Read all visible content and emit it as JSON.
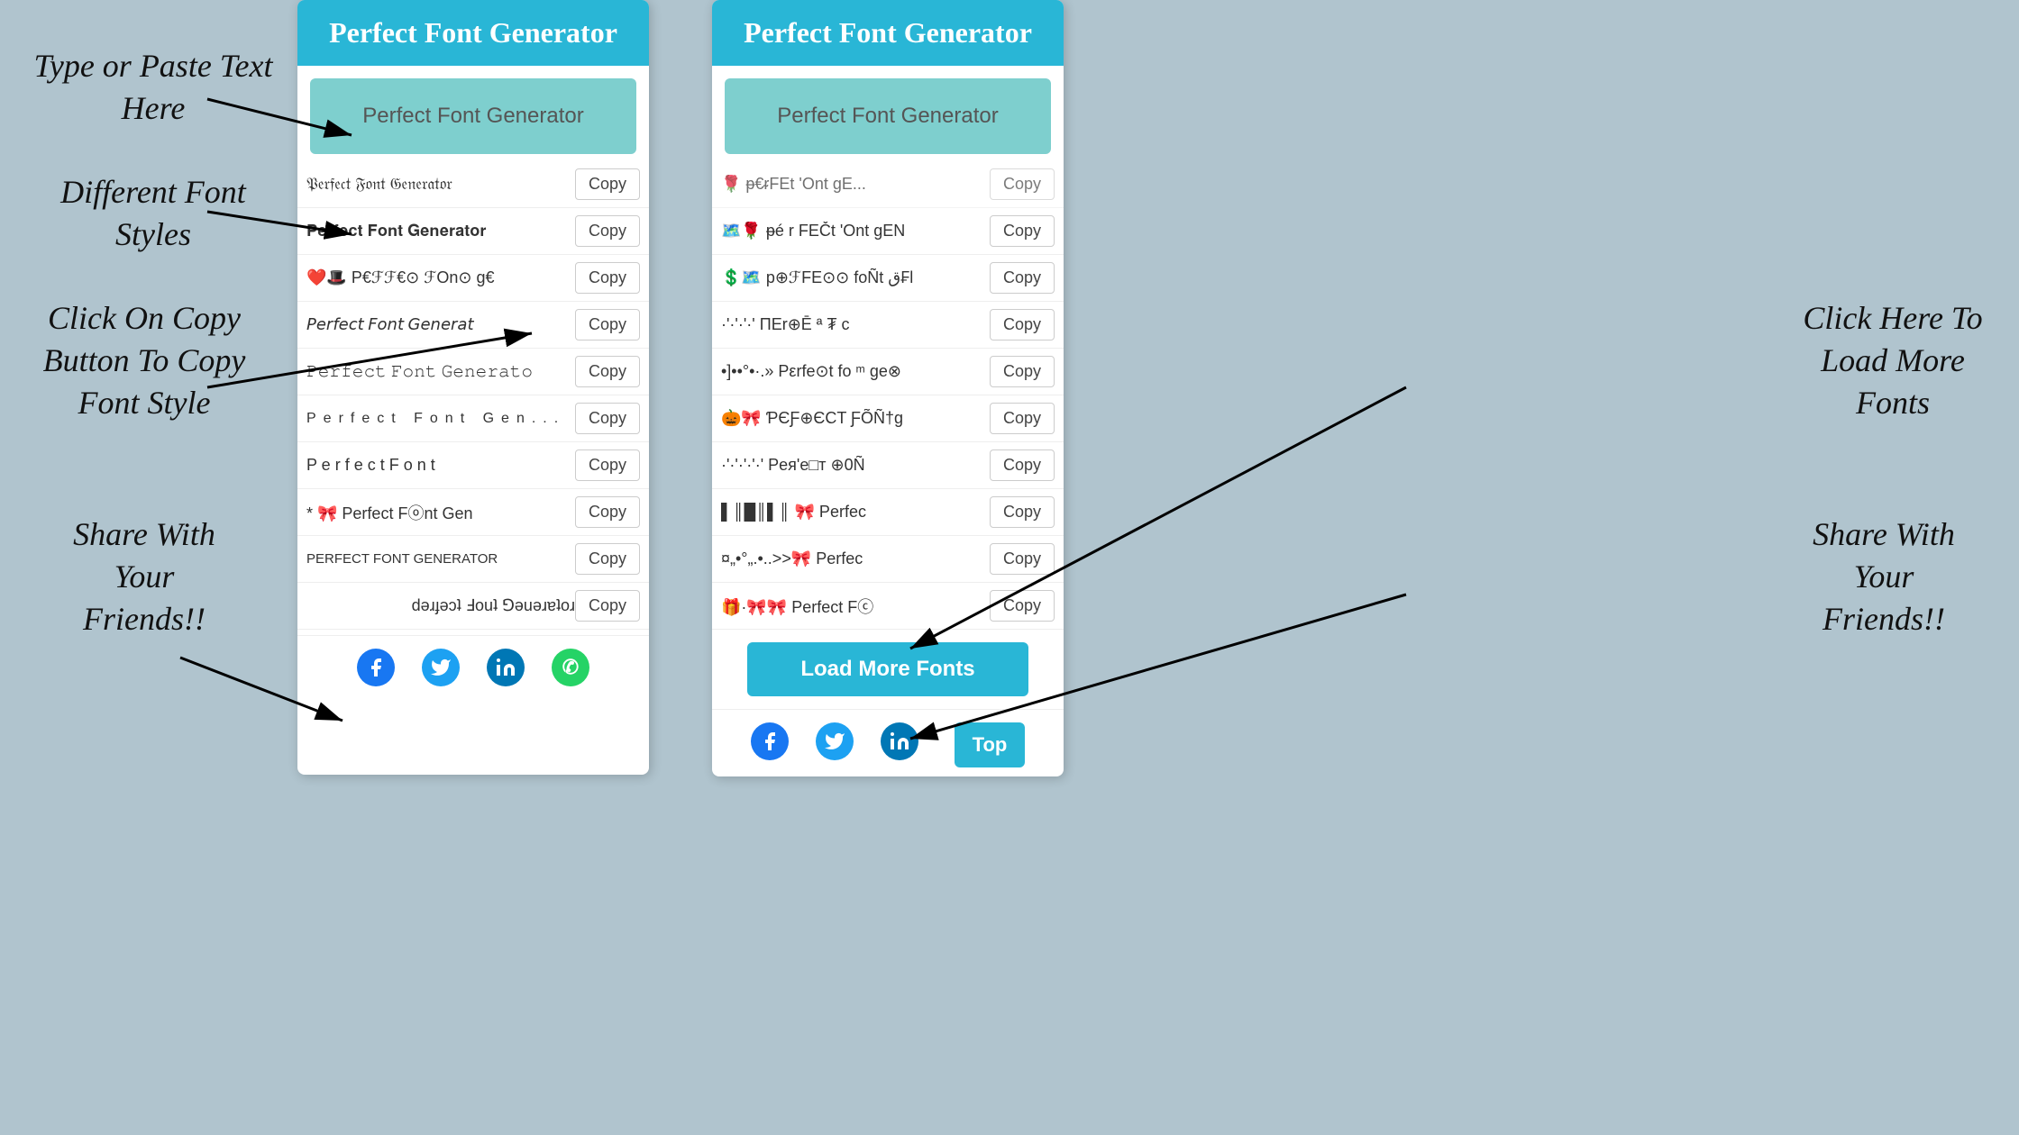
{
  "app": {
    "title": "Perfect Font Generator",
    "input_placeholder": "Perfect Font Generator",
    "input_value": "Perfect Font Generator"
  },
  "annotations": {
    "type_paste": "Type or Paste Text\nHere",
    "different_fonts": "Different Font\nStyles",
    "click_copy": "Click On Copy\nButton To Copy\nFont Style",
    "share": "Share With\nYour\nFriends!!",
    "click_load": "Click Here To\nLoad More\nFonts",
    "share_right": "Share With\nYour\nFriends!!"
  },
  "buttons": {
    "copy": "Copy",
    "load_more": "Load More Fonts",
    "top": "Top"
  },
  "social": {
    "facebook": "f",
    "twitter": "🐦",
    "linkedin": "in",
    "whatsapp": "✆"
  },
  "left_panel": {
    "header": "Perfect Font Generator",
    "rows": [
      {
        "text": "𝔓𝔢𝔯𝔣𝔢𝔠𝔱 𝔉𝔬𝔫𝔱 𝔊𝔢𝔫𝔢𝔯𝔞𝔱𝔬𝔯",
        "copy": "Copy"
      },
      {
        "text": "𝐏𝐞𝐫𝐟𝐞𝐜𝐭 𝐅𝐨𝐧𝐭 𝐆𝐞𝐧𝐞𝐫𝐚𝐭𝐨𝐫",
        "copy": "Copy"
      },
      {
        "text": "❤️🎩 P€ℱℱ€⊙ ℱOn⊙ g€",
        "copy": "Copy"
      },
      {
        "text": "𝘗𝘦𝘳𝘧𝘦𝘤𝘵 𝘍𝘰𝘯𝘵 𝘎𝘦𝘯𝘦𝘳𝘢𝘵",
        "copy": "Copy"
      },
      {
        "text": "𝙿𝚎𝚛𝚏𝚎𝚌𝚝 𝙵𝚘𝚗𝚝 𝙶𝚎𝚗𝚎𝚛𝚊𝚝𝚘",
        "copy": "Copy"
      },
      {
        "text": "Perfect Font Generator",
        "copy": "Copy",
        "spaced": true
      },
      {
        "text": "P e r f e c t  F o n t",
        "copy": "Copy"
      },
      {
        "text": "* 🎀 Perfect Fⓞnt Gen",
        "copy": "Copy"
      },
      {
        "text": "PERFECT FONT GENERATOR",
        "copy": "Copy"
      },
      {
        "text": "ɹoʇɐɹǝuǝ⅁ ʇuoℲ ʇɔǝɟɹǝd",
        "copy": "Copy"
      }
    ]
  },
  "right_panel_1": {
    "header": "Perfect Font Generator",
    "input_value": "Perfect Font Generator",
    "rows": [
      {
        "text": "ᵽ€ᵲFEČt 'Ont gEN",
        "copy": "Copy",
        "prefix": "🗺️🌹"
      },
      {
        "text": "p⊕ℱFE⊙⊙ foÑt ق₣l",
        "copy": "Copy",
        "prefix": "💲🗺️"
      },
      {
        "text": "ΠΕr⊕Ē ª ₮ c",
        "copy": "Copy",
        "prefix": "·'·'·'·'"
      },
      {
        "text": "Pεrfe⊙t fo ᵐ ge⊗",
        "copy": "Copy",
        "prefix": "•]••°•·.»"
      },
      {
        "text": "ƤЄƑ⊕ЄCT ƑÕÑ†g",
        "copy": "Copy",
        "prefix": "🎃🎀"
      },
      {
        "text": "Peя'e□т ⊕0Ñ",
        "copy": "Copy",
        "prefix": "·'·'·'·'·'"
      },
      {
        "text": "🎀 Perfec",
        "copy": "Copy",
        "prefix": "▌║█║▌║"
      },
      {
        "text": "🎀 Perfec",
        "copy": "Copy",
        "prefix": "¤„•°„.•..>>🎀"
      },
      {
        "text": "Perfect Fⓒ",
        "copy": "Copy",
        "prefix": "🎁·🎀🎀"
      }
    ],
    "load_more": "Load More Fonts"
  },
  "colors": {
    "header_bg": "#29b6d6",
    "input_bg": "#7ecfce",
    "load_more_bg": "#29b6d6",
    "top_btn_bg": "#29b6d6",
    "page_bg": "#b0c4ce"
  }
}
